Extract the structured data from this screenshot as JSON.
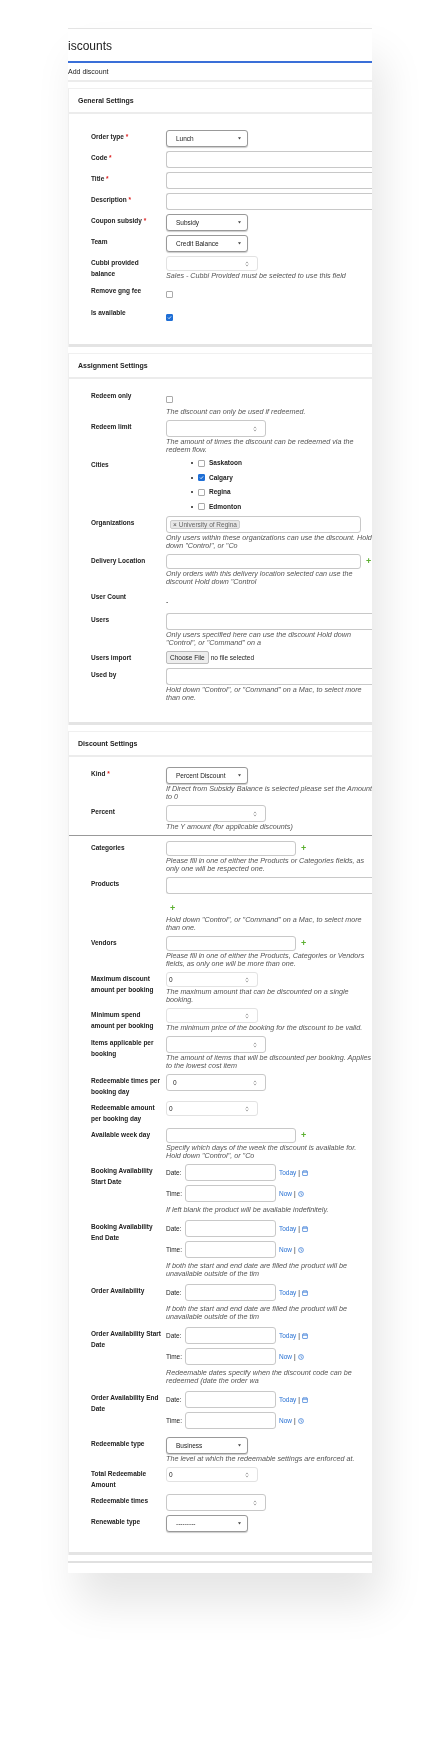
{
  "page_title": "iscounts",
  "subtitle": "Add discount",
  "sections": [
    {
      "title": "General Settings",
      "fields": [
        {
          "kind": "select",
          "label": "Order type",
          "asterisk": "*",
          "value": "Lunch"
        },
        {
          "kind": "text",
          "label": "Code",
          "asterisk": "*"
        },
        {
          "kind": "text",
          "label": "Title",
          "asterisk": "*"
        },
        {
          "kind": "text",
          "label": "Description",
          "asterisk": "*"
        },
        {
          "kind": "select",
          "label": "Coupon subsidy",
          "asterisk": "*",
          "value": "Subsidy"
        },
        {
          "kind": "select",
          "label": "Team",
          "value": "Credit Balance"
        },
        {
          "kind": "decimal",
          "label": "Cubbi provided balance",
          "help": "Sales - Cubbi Provided must be selected to use this field"
        },
        {
          "kind": "checkbox",
          "label": "Remove gng fee",
          "checked": false
        },
        {
          "kind": "checkbox",
          "label": "Is available",
          "checked": true
        }
      ]
    },
    {
      "title": "Assignment Settings",
      "fields": [
        {
          "kind": "checkbox",
          "label": "Redeem only",
          "checked": false,
          "help": "The discount can only be used if redeemed."
        },
        {
          "kind": "number",
          "label": "Redeem limit",
          "help": "The amount of times the discount can be redeemed via the redeem flow."
        },
        {
          "kind": "checklist",
          "label": "Cities",
          "options": [
            {
              "label": "Saskatoon",
              "checked": false
            },
            {
              "label": "Calgary",
              "checked": true
            },
            {
              "label": "Regina",
              "checked": false
            },
            {
              "label": "Edmonton",
              "checked": false
            }
          ]
        },
        {
          "kind": "tags",
          "label": "Organizations",
          "tags": [
            {
              "remove": "×",
              "label": "University of Regina"
            }
          ],
          "help": "Only users within these organizations can use the discount. Hold down \"Control\", or \"Co"
        },
        {
          "kind": "multi",
          "label": "Delivery Location",
          "add": "+",
          "help": "Only orders with this delivery location selected can use the discount Hold down \"Control"
        },
        {
          "kind": "static",
          "label": "User Count",
          "value": "-"
        },
        {
          "kind": "text",
          "label": "Users",
          "help": "Only users specified here can use the discount Hold down \"Control\", or \"Command\" on a"
        },
        {
          "kind": "file",
          "label": "Users import",
          "button": "Choose File",
          "value": "no file selected"
        },
        {
          "kind": "text",
          "label": "Used by",
          "help": "Hold down \"Control\", or \"Command\" on a Mac, to select more than one."
        }
      ]
    },
    {
      "title": "Discount Settings",
      "fields": [
        {
          "kind": "select",
          "label": "Kind",
          "asterisk": "*",
          "value": "Percent Discount",
          "help": "If Direct from Subsidy Balance is selected please set the Amount to 0"
        },
        {
          "kind": "number",
          "label": "Percent",
          "help": "The Y amount (for applicable discounts)",
          "divider_after": true
        },
        {
          "kind": "multi",
          "label": "Categories",
          "add": "+",
          "help": "Please fill in one of either the Products or Categories fields, as only one will be respected one."
        },
        {
          "kind": "text",
          "label": "Products",
          "add_below": "+",
          "help": "Hold down \"Control\", or \"Command\" on a Mac, to select more than one."
        },
        {
          "kind": "multi",
          "label": "Vendors",
          "add": "+",
          "help": "Please fill in one of either the Products, Categories or Vendors fields, as only one will be more than one."
        },
        {
          "kind": "decimal",
          "label": "Maximum discount amount per booking",
          "value": "0",
          "help": "The maximum amount that can be discounted on a single booking."
        },
        {
          "kind": "decimal",
          "label": "Minimum spend amount per booking",
          "help": "The minimum price of the booking for the discount to be valid."
        },
        {
          "kind": "number",
          "label": "Items applicable per booking",
          "help": "The amount of items that will be discounted per booking. Applies to the lowest cost item"
        },
        {
          "kind": "number",
          "label": "Redeemable times per booking day",
          "value": "0"
        },
        {
          "kind": "decimal",
          "label": "Redeemable amount per booking day",
          "value": "0"
        },
        {
          "kind": "multi",
          "label": "Available week day",
          "add": "+",
          "help": "Specify which days of the week the discount is available for. Hold down \"Control\", or \"Co"
        },
        {
          "kind": "datetime",
          "label": "Booking Availability Start Date",
          "date": {
            "label": "Date:",
            "link": "Today",
            "sep": "|"
          },
          "time": {
            "label": "Time:",
            "link": "Now",
            "sep": "|"
          },
          "help": "If left blank the product will be available indefinitely."
        },
        {
          "kind": "datetime",
          "label": "Booking Availability End Date",
          "date": {
            "label": "Date:",
            "link": "Today",
            "sep": "|"
          },
          "time": {
            "label": "Time:",
            "link": "Now",
            "sep": "|"
          },
          "help": "If both the start and end date are filled the product will be unavailable outside of the tim"
        },
        {
          "kind": "datetime",
          "label": "Order Availability",
          "date": {
            "label": "Date:",
            "link": "Today",
            "sep": "|"
          },
          "help": "If both the start and end date are filled the product will be unavailable outside of the tim"
        },
        {
          "kind": "datetime",
          "label": "Order Availability Start Date",
          "date": {
            "label": "Date:",
            "link": "Today",
            "sep": "|"
          },
          "time": {
            "label": "Time:",
            "link": "Now",
            "sep": "|"
          },
          "help": "Redeemable dates specify when the discount code can be redeemed (date the order wa"
        },
        {
          "kind": "datetime",
          "label": "Order Availability End Date",
          "date": {
            "label": "Date:",
            "link": "Today",
            "sep": "|"
          },
          "time": {
            "label": "Time:",
            "link": "Now",
            "sep": "|"
          }
        },
        {
          "kind": "select",
          "label": "Redeemable type",
          "value": "Business",
          "help": "The level at which the redeemable settings are enforced at."
        },
        {
          "kind": "decimal",
          "label": "Total Redeemable Amount",
          "value": "0"
        },
        {
          "kind": "number",
          "label": "Redeemable times"
        },
        {
          "kind": "select",
          "label": "Renewable type",
          "value": "---------"
        }
      ]
    }
  ]
}
